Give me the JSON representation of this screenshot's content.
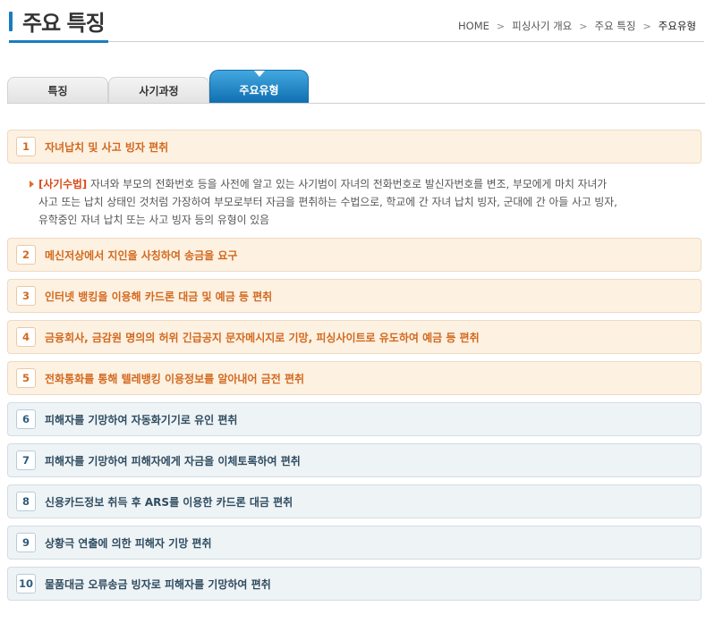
{
  "header": {
    "title": "주요 특징"
  },
  "breadcrumb": {
    "items": [
      "HOME",
      "피싱사기 개요",
      "주요 특징"
    ],
    "current": "주요유형"
  },
  "tabs": [
    {
      "label": "특징",
      "active": false
    },
    {
      "label": "사기과정",
      "active": false
    },
    {
      "label": "주요유형",
      "active": true
    }
  ],
  "items": [
    {
      "num": "1",
      "label": "자녀납치 및 사고 빙자 편취",
      "color": "orange"
    },
    {
      "num": "2",
      "label": "메신저상에서 지인을 사칭하여 송금을 요구",
      "color": "orange"
    },
    {
      "num": "3",
      "label": "인터넷 뱅킹을 이용해 카드론 대금 및 예금 등 편취",
      "color": "orange"
    },
    {
      "num": "4",
      "label": "금융회사, 금감원 명의의 허위 긴급공지 문자메시지로 기망, 피싱사이트로 유도하여 예금 등 편취",
      "color": "orange"
    },
    {
      "num": "5",
      "label": "전화통화를 통해 텔레뱅킹 이용정보를 알아내어 금전 편취",
      "color": "orange"
    },
    {
      "num": "6",
      "label": "피해자를 기망하여 자동화기기로 유인 편취",
      "color": "blue"
    },
    {
      "num": "7",
      "label": "피해자를 기망하여 피해자에게 자금을 이체토록하여 편취",
      "color": "blue"
    },
    {
      "num": "8",
      "label": "신용카드정보 취득 후 ARS를 이용한 카드론 대금 편취",
      "color": "blue"
    },
    {
      "num": "9",
      "label": "상황극 연출에 의한 피해자 기망 편취",
      "color": "blue"
    },
    {
      "num": "10",
      "label": "물품대금 오류송금 빙자로 피해자를 기망하여 편취",
      "color": "blue"
    }
  ],
  "detail": {
    "method_label": "[사기수법]",
    "line1": " 자녀와 부모의 전화번호 등을 사전에 알고 있는 사기범이 자녀의 전화번호로 발신자번호를 변조, 부모에게 마치 자녀가",
    "line2": "사고 또는 납치 상태인 것처럼 가장하여 부모로부터 자금을 편취하는 수법으로, 학교에 간 자녀 납치 빙자, 군대에 간 아들 사고 빙자,",
    "line3": "유학중인 자녀 납치 또는 사고 빙자 등의 유형이 있음"
  },
  "colors": {
    "accent": "#1a7cc0",
    "orange_text": "#d2691e",
    "orange_bg": "#fdf1e2",
    "blue_text": "#2f4c60",
    "blue_bg": "#eef3f6"
  }
}
